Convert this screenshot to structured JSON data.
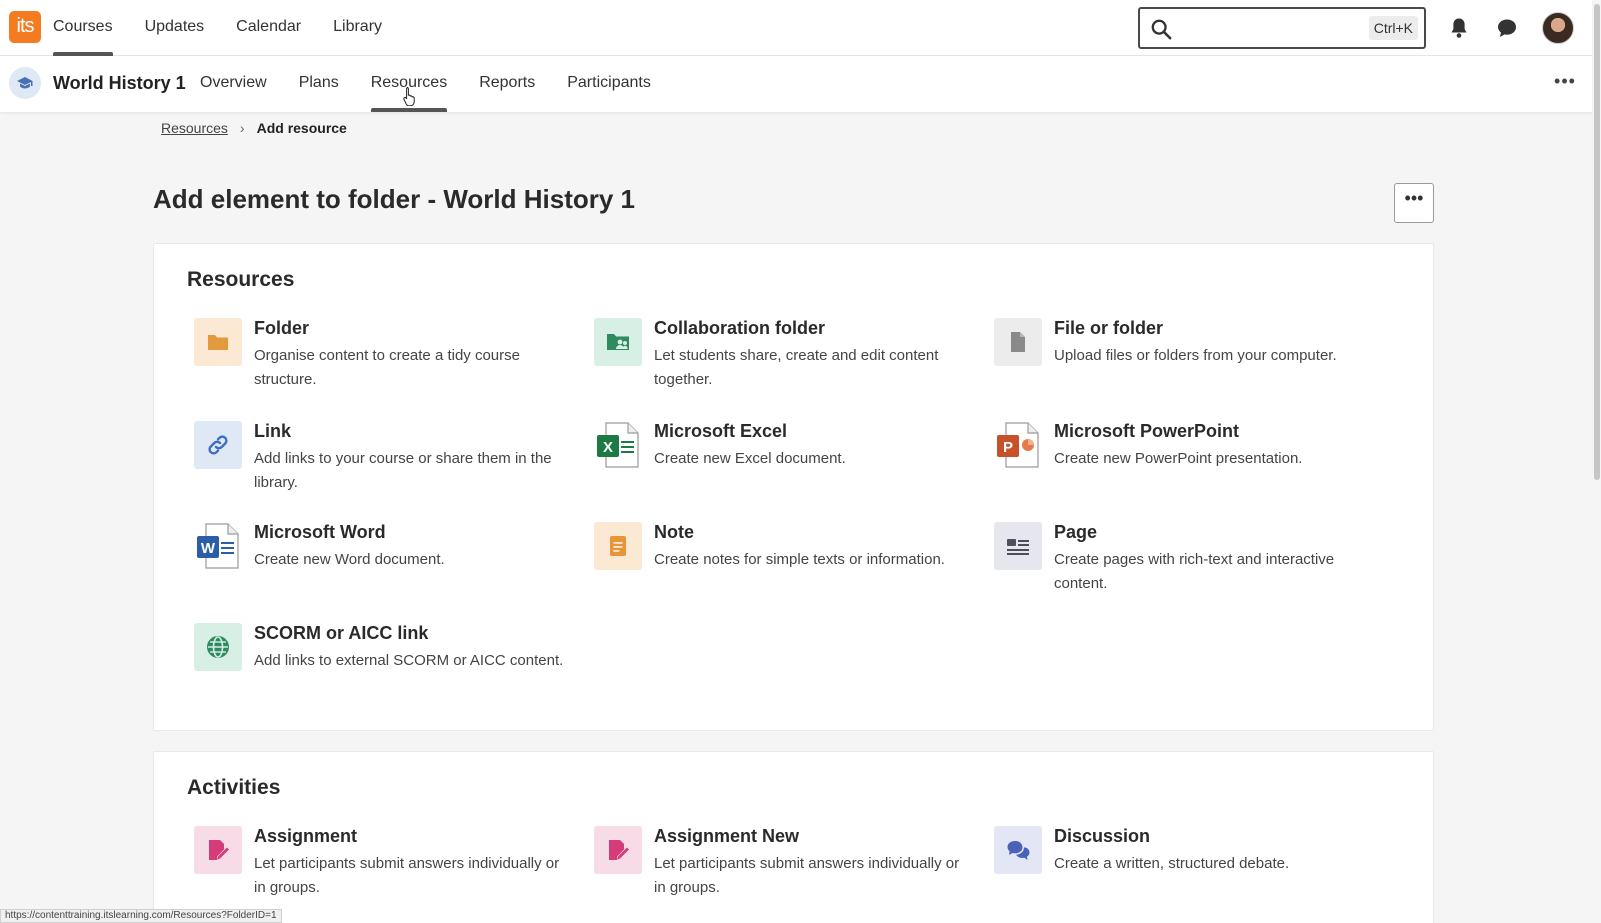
{
  "topnav": {
    "logo_text": "its",
    "items": [
      {
        "label": "Courses",
        "active": true
      },
      {
        "label": "Updates"
      },
      {
        "label": "Calendar"
      },
      {
        "label": "Library"
      }
    ],
    "search": {
      "placeholder": "",
      "shortcut": "Ctrl+K"
    }
  },
  "course": {
    "title": "World History 1",
    "tabs": [
      {
        "label": "Overview"
      },
      {
        "label": "Plans"
      },
      {
        "label": "Resources",
        "active": true
      },
      {
        "label": "Reports"
      },
      {
        "label": "Participants"
      }
    ]
  },
  "breadcrumb": {
    "parent": "Resources",
    "current": "Add resource"
  },
  "page": {
    "title": "Add element to folder - World History 1"
  },
  "resources": {
    "title": "Resources",
    "items": [
      {
        "title": "Folder",
        "desc": "Organise content to create a tidy course structure."
      },
      {
        "title": "Collaboration folder",
        "desc": "Let students share, create and edit content together."
      },
      {
        "title": "File or folder",
        "desc": "Upload files or folders from your computer."
      },
      {
        "title": "Link",
        "desc": "Add links to your course or share them in the library."
      },
      {
        "title": "Microsoft Excel",
        "desc": "Create new Excel document."
      },
      {
        "title": "Microsoft PowerPoint",
        "desc": "Create new PowerPoint presentation."
      },
      {
        "title": "Microsoft Word",
        "desc": "Create new Word document."
      },
      {
        "title": "Note",
        "desc": "Create notes for simple texts or information."
      },
      {
        "title": "Page",
        "desc": "Create pages with rich-text and interactive content."
      },
      {
        "title": "SCORM or AICC link",
        "desc": "Add links to external SCORM or AICC content."
      }
    ]
  },
  "activities": {
    "title": "Activities",
    "items": [
      {
        "title": "Assignment",
        "desc": "Let participants submit answers individually or in groups."
      },
      {
        "title": "Assignment New",
        "desc": "Let participants submit answers individually or in groups."
      },
      {
        "title": "Discussion",
        "desc": "Create a written, structured debate."
      }
    ]
  },
  "status_url": "https://contenttraining.itslearning.com/Resources?FolderID=1",
  "colors": {
    "brand": "#f47b20",
    "folder_bg": "#fbe9d3",
    "folder_fg": "#e29a3c",
    "collab_bg": "#d7efe4",
    "collab_fg": "#2f8a5e",
    "file_bg": "#ececec",
    "link_bg": "#dfe8f5",
    "assignment_bg": "#f7dbe6",
    "assignment_fg": "#d63b7a",
    "discussion_bg": "#e3e6f5",
    "discussion_fg": "#4a63b8"
  }
}
